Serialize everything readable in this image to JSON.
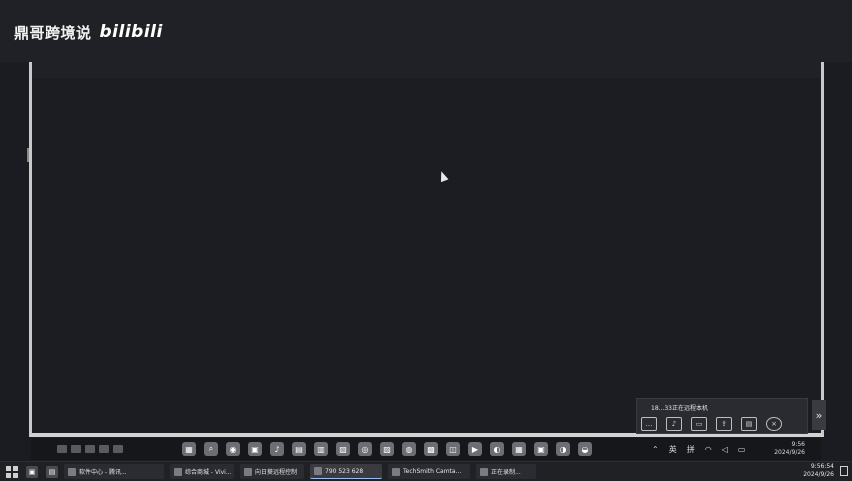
{
  "watermark": {
    "channel": "鼎哥跨境说",
    "logo": "bilibili"
  },
  "remote_overlay": {
    "status": "18...33正在远程本机",
    "icons": [
      "chat-icon",
      "microphone-icon",
      "screen-share-icon",
      "file-transfer-icon",
      "folder-icon",
      "close-icon"
    ]
  },
  "side_toggle": {
    "glyph": "»"
  },
  "inner_taskbar": {
    "tray": {
      "ime": "英",
      "ime2": "拼"
    },
    "clock": {
      "time": "9:56",
      "date": "2024/9/26"
    }
  },
  "outer_taskbar": {
    "tasks": [
      {
        "label": "软件中心 - 腾讯..."
      },
      {
        "label": "综合商城 - Vivi..."
      },
      {
        "label": "向日葵远程控制"
      },
      {
        "label": "790 523 628"
      },
      {
        "label": "TechSmith Camta..."
      },
      {
        "label": "正在录制..."
      }
    ],
    "clock": {
      "time": "9:56:54",
      "date": "2024/9/26"
    }
  }
}
